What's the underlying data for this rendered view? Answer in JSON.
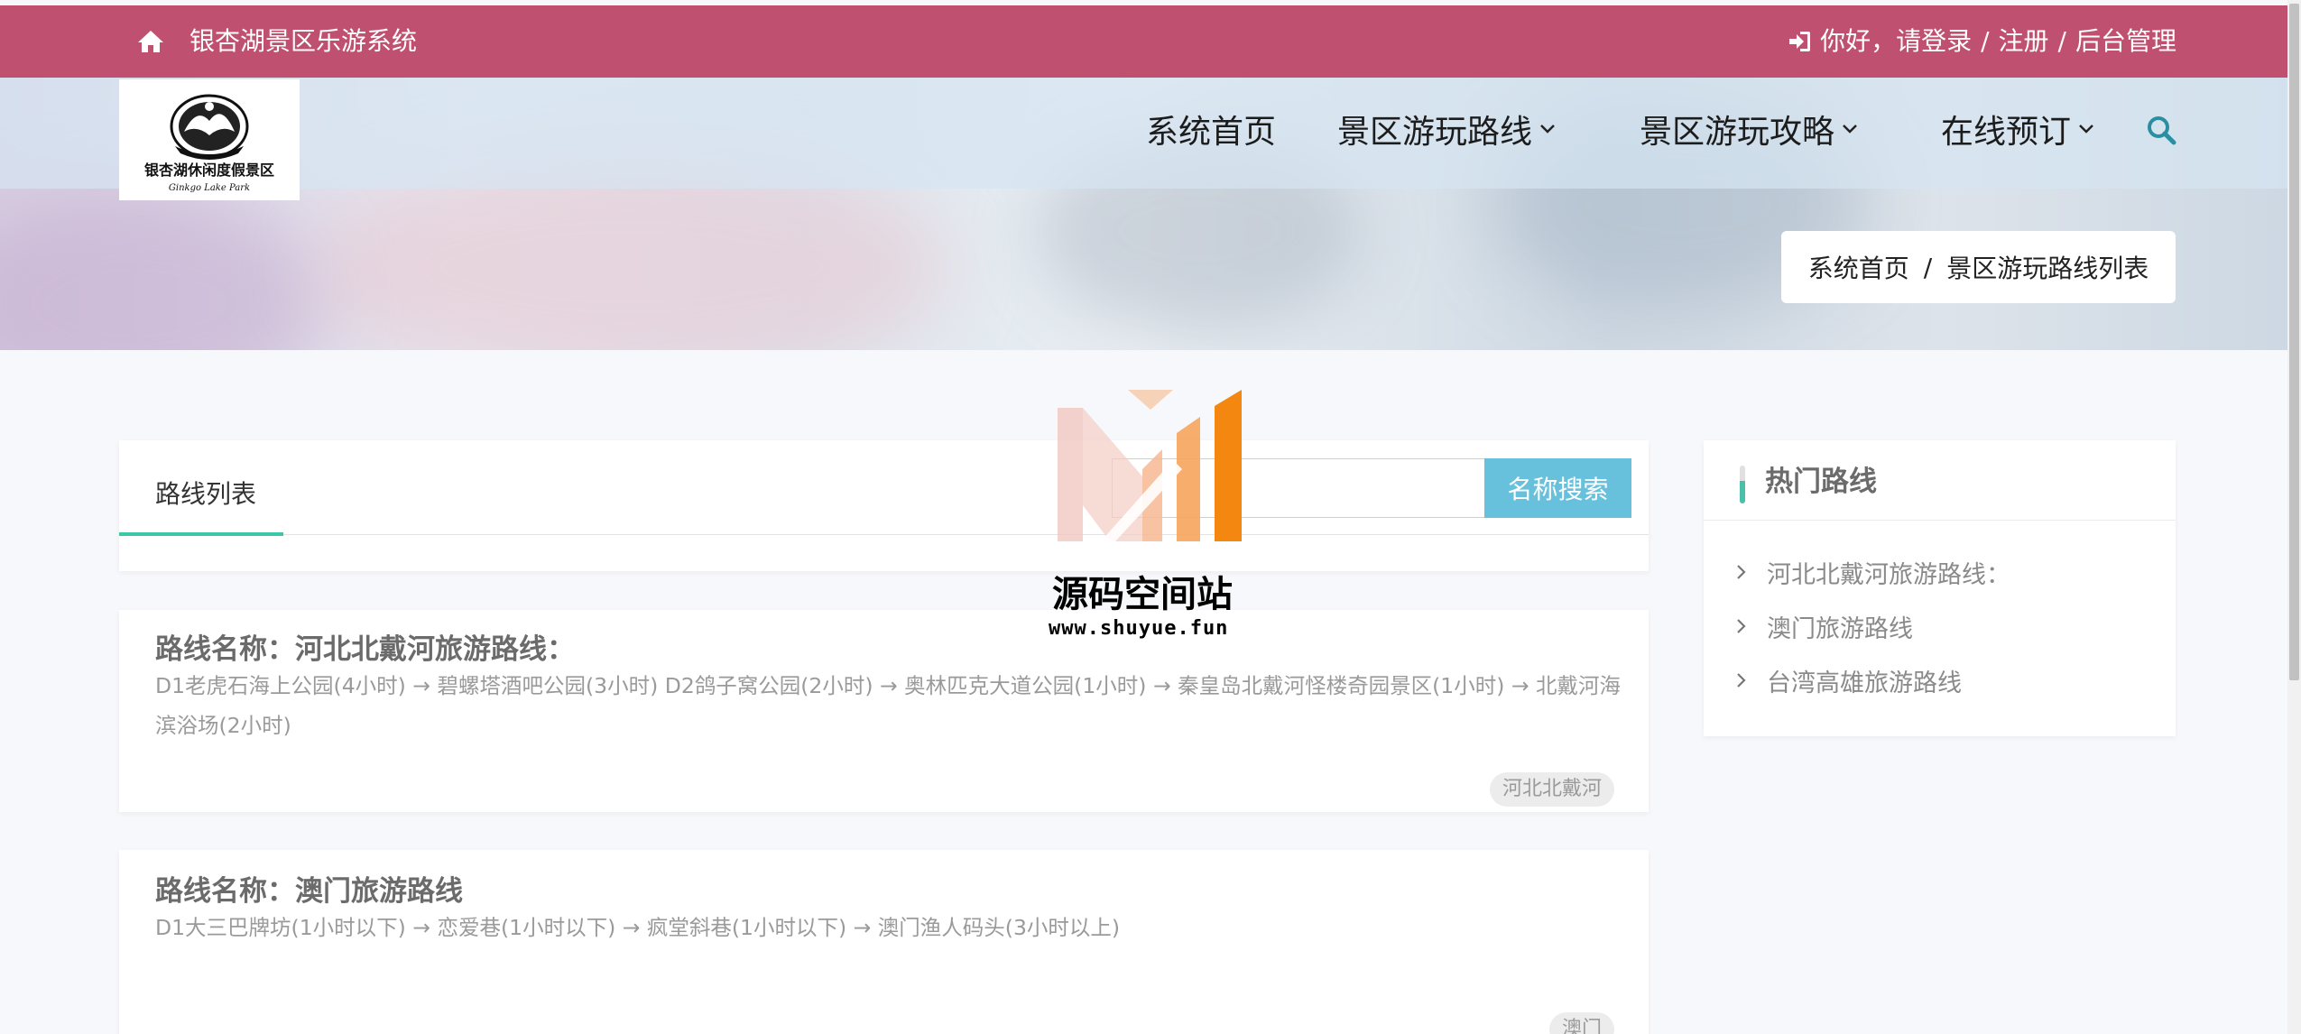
{
  "topbar": {
    "site_title": "银杏湖景区乐游系统",
    "greeting": "你好，请登录",
    "sep1": "/",
    "register": "注册",
    "sep2": "/",
    "admin": "后台管理"
  },
  "logo": {
    "text": "银杏湖休闲度假景区",
    "alt_text": "Ginkgo Lake Park"
  },
  "nav": {
    "items": [
      {
        "label": "系统首页"
      },
      {
        "label": "景区游玩路线"
      },
      {
        "label": "景区游玩攻略"
      },
      {
        "label": "在线预订"
      }
    ],
    "search_icon": "search-icon"
  },
  "breadcrumb": {
    "home": "系统首页",
    "sep": "/",
    "current": "景区游玩路线列表"
  },
  "list": {
    "tab_label": "路线列表",
    "search_placeholder": "",
    "search_button": "名称搜索",
    "cards": [
      {
        "name": "路线名称：河北北戴河旅游路线：",
        "desc": "D1老虎石海上公园(4小时) → 碧螺塔酒吧公园(3小时) D2鸽子窝公园(2小时) → 奥林匹克大道公园(1小时) → 秦皇岛北戴河怪楼奇园景区(1小时) → 北戴河海滨浴场(2小时)",
        "tag": "河北北戴河"
      },
      {
        "name": "路线名称：澳门旅游路线",
        "desc": "D1大三巴牌坊(1小时以下) → 恋爱巷(1小时以下) → 疯堂斜巷(1小时以下) → 澳门渔人码头(3小时以上)",
        "tag": "澳门"
      }
    ]
  },
  "sidebar": {
    "title": "热门路线",
    "items": [
      {
        "label": "河北北戴河旅游路线："
      },
      {
        "label": "澳门旅游路线"
      },
      {
        "label": "台湾高雄旅游路线"
      }
    ]
  },
  "watermark": {
    "name": "源码空间站",
    "url": "www.shuyue.fun"
  },
  "colors": {
    "topbar": "#c0506f",
    "accent": "#3cc7a8",
    "search_button": "#67c1dc"
  }
}
